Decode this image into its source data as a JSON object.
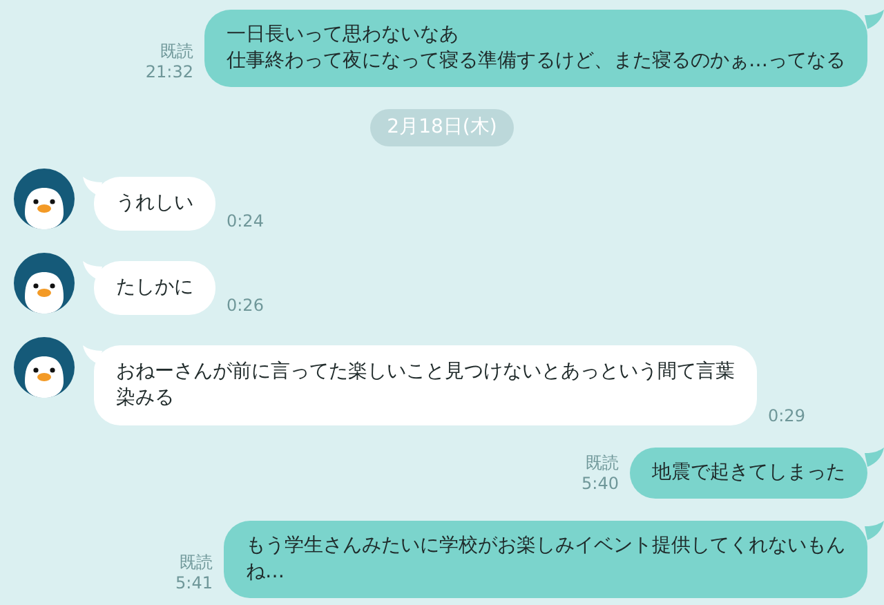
{
  "messages": [
    {
      "kind": "sent",
      "lines": [
        "一日長いって思わないなあ",
        "仕事終わって夜になって寝る準備するけど、また寝るのかぁ…ってなる"
      ],
      "read": "既読",
      "time": "21:32"
    },
    {
      "kind": "date",
      "text": "2月18日(木)"
    },
    {
      "kind": "received",
      "lines": [
        "うれしい"
      ],
      "time": "0:24"
    },
    {
      "kind": "received",
      "lines": [
        "たしかに"
      ],
      "time": "0:26"
    },
    {
      "kind": "received",
      "lines": [
        "おねーさんが前に言ってた楽しいこと見つけないとあっという間て言葉",
        "染みる"
      ],
      "time": "0:29"
    },
    {
      "kind": "sent",
      "lines": [
        "地震で起きてしまった"
      ],
      "read": "既読",
      "time": "5:40"
    },
    {
      "kind": "sent",
      "lines": [
        "もう学生さんみたいに学校がお楽しみイベント提供してくれないもん",
        "ね…"
      ],
      "read": "既読",
      "time": "5:41"
    }
  ]
}
